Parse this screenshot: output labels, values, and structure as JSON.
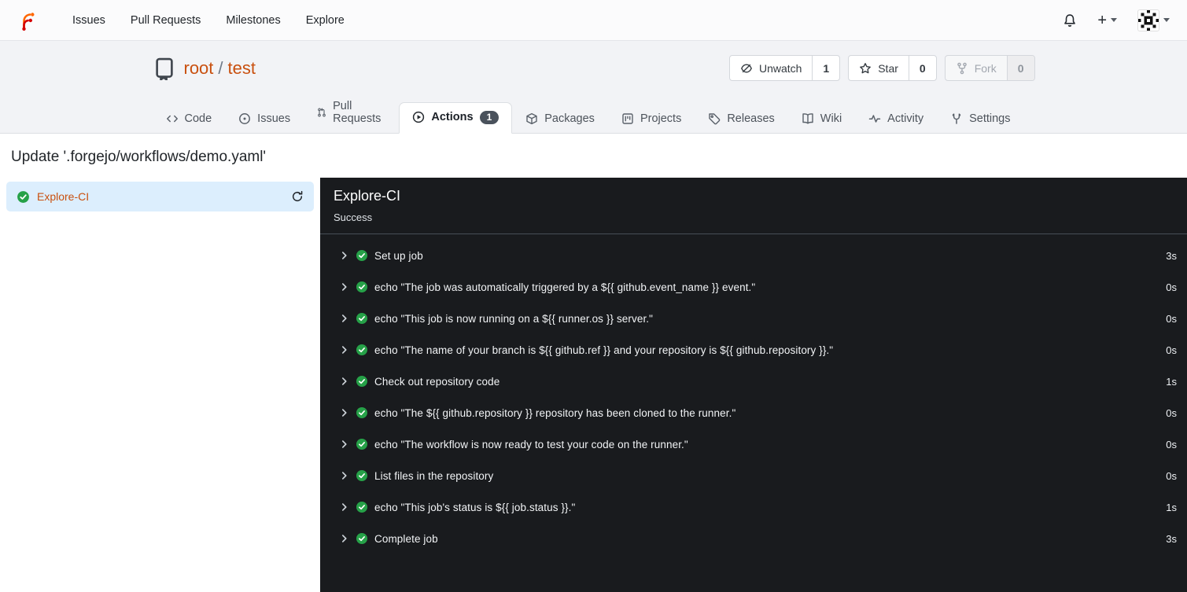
{
  "navbar": {
    "links": [
      {
        "label": "Issues"
      },
      {
        "label": "Pull Requests"
      },
      {
        "label": "Milestones"
      },
      {
        "label": "Explore"
      }
    ],
    "new_button_label": "+"
  },
  "repo": {
    "owner": "root",
    "separator": "/",
    "name": "test",
    "actions": [
      {
        "label": "Unwatch",
        "count": "1",
        "icon": "eye-slash-icon"
      },
      {
        "label": "Star",
        "count": "0",
        "icon": "star-icon"
      },
      {
        "label": "Fork",
        "count": "0",
        "icon": "fork-icon",
        "disabled": true
      }
    ],
    "tabs": [
      {
        "label": "Code",
        "icon": "code-icon"
      },
      {
        "label": "Issues",
        "icon": "issue-icon"
      },
      {
        "label": "Pull Requests",
        "icon": "pull-request-icon"
      },
      {
        "label": "Actions",
        "icon": "play-circle-icon",
        "active": true,
        "badge": "1"
      },
      {
        "label": "Packages",
        "icon": "package-icon"
      },
      {
        "label": "Projects",
        "icon": "project-icon"
      },
      {
        "label": "Releases",
        "icon": "tag-icon"
      },
      {
        "label": "Wiki",
        "icon": "book-icon"
      },
      {
        "label": "Activity",
        "icon": "pulse-icon"
      }
    ],
    "settings_tab": {
      "label": "Settings",
      "icon": "tools-icon"
    }
  },
  "run": {
    "title": "Update '.forgejo/workflows/demo.yaml'",
    "jobs": [
      {
        "name": "Explore-CI",
        "status": "success"
      }
    ],
    "panel": {
      "job_name": "Explore-CI",
      "status_text": "Success",
      "steps": [
        {
          "name": "Set up job",
          "duration": "3s"
        },
        {
          "name": "echo \"The job was automatically triggered by a ${{ github.event_name }} event.\"",
          "duration": "0s"
        },
        {
          "name": "echo \"This job is now running on a ${{ runner.os }} server.\"",
          "duration": "0s"
        },
        {
          "name": "echo \"The name of your branch is ${{ github.ref }} and your repository is ${{ github.repository }}.\"",
          "duration": "0s"
        },
        {
          "name": "Check out repository code",
          "duration": "1s"
        },
        {
          "name": "echo \"The ${{ github.repository }} repository has been cloned to the runner.\"",
          "duration": "0s"
        },
        {
          "name": "echo \"The workflow is now ready to test your code on the runner.\"",
          "duration": "0s"
        },
        {
          "name": "List files in the repository",
          "duration": "0s"
        },
        {
          "name": "echo \"This job's status is ${{ job.status }}.\"",
          "duration": "1s"
        },
        {
          "name": "Complete job",
          "duration": "3s"
        }
      ]
    }
  },
  "colors": {
    "primary_link": "#c9500f",
    "success_green": "#26a148",
    "selected_job_bg": "#dceefd",
    "panel_bg": "#191b1e",
    "badge_bg": "#4a525c"
  }
}
